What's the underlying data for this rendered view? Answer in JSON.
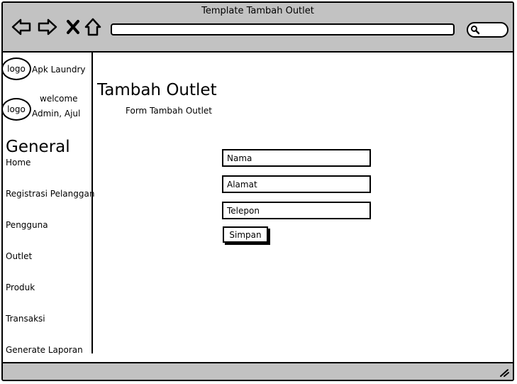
{
  "window": {
    "title": "Template Tambah Outlet"
  },
  "browser": {
    "nav": [
      {
        "name": "back-icon"
      },
      {
        "name": "forward-icon"
      },
      {
        "name": "close-icon"
      },
      {
        "name": "home-icon"
      }
    ],
    "url": "",
    "search_icon": "search-icon"
  },
  "sidebar": {
    "logo_label": "logo",
    "app_name": "Apk Laundry",
    "avatar_label": "logo",
    "welcome": "welcome",
    "user": "Admin, Ajul",
    "section": "General",
    "items": [
      {
        "label": "Home"
      },
      {
        "label": "Registrasi Pelanggan"
      },
      {
        "label": "Pengguna"
      },
      {
        "label": "Outlet"
      },
      {
        "label": "Produk"
      },
      {
        "label": "Transaksi"
      },
      {
        "label": "Generate Laporan"
      }
    ]
  },
  "main": {
    "title": "Tambah Outlet",
    "subtitle": "Form Tambah Outlet",
    "form": {
      "nama_placeholder": "Nama",
      "alamat_placeholder": "Alamat",
      "telepon_placeholder": "Telepon",
      "submit_label": "Simpan"
    }
  }
}
